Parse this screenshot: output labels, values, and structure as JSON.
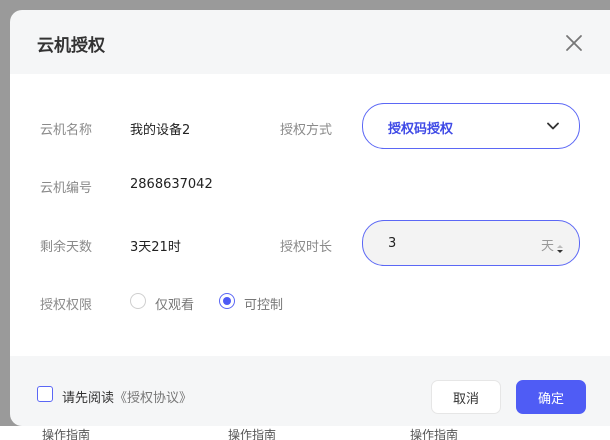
{
  "background_text": [
    "操作指南",
    "操作指南",
    "操作指南"
  ],
  "dialog": {
    "title": "云机授权",
    "close_icon": "close-icon"
  },
  "form": {
    "cloud_name_label": "云机名称",
    "cloud_name_value": "我的设备2",
    "auth_method_label": "授权方式",
    "auth_method_selected": "授权码授权",
    "cloud_id_label": "云机编号",
    "cloud_id_value": "2868637042",
    "remaining_label": "剩余天数",
    "remaining_value": "3天21时",
    "duration_label": "授权时长",
    "duration_value": "3",
    "duration_unit": "天",
    "permission_label": "授权权限",
    "permission_options": [
      {
        "label": "仅观看",
        "selected": false
      },
      {
        "label": "可控制",
        "selected": true
      }
    ]
  },
  "footer": {
    "agree_prefix": "请先阅读",
    "agree_link": "《授权协议》",
    "agree_checked": false,
    "cancel_label": "取消",
    "confirm_label": "确定"
  },
  "colors": {
    "accent": "#4f5cf5",
    "accent_text": "#3f4ae6",
    "label_gray": "#8a8a8a"
  }
}
